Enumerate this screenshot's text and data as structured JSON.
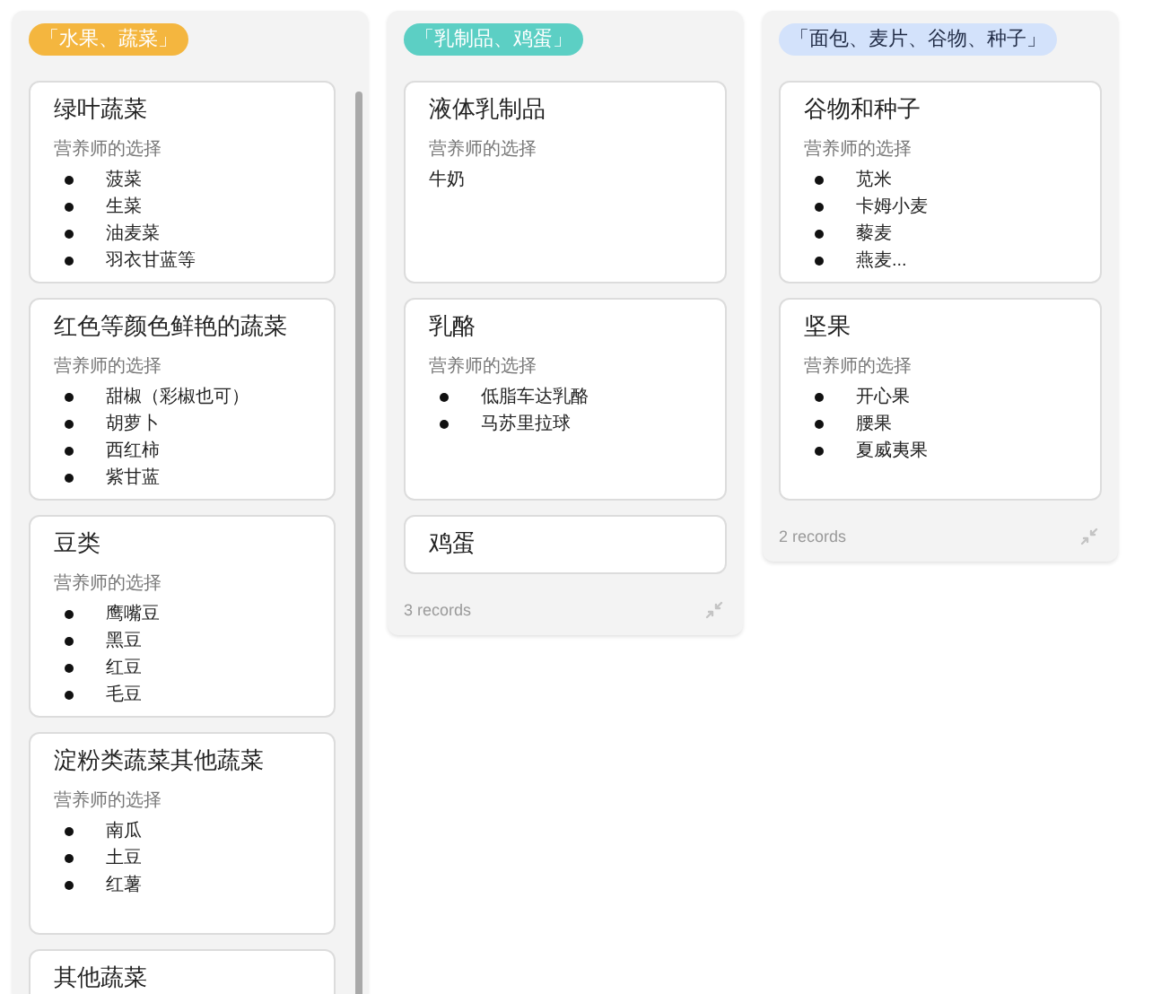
{
  "columns": [
    {
      "label": "「水果、蔬菜」",
      "color": "#f4b63f",
      "cards": [
        {
          "title": "绿叶蔬菜",
          "field_label": "营养师的选择",
          "kind": "list",
          "items": [
            "菠菜",
            "生菜",
            "油麦菜",
            "羽衣甘蓝等"
          ]
        },
        {
          "title": "红色等颜色鲜艳的蔬菜",
          "field_label": "营养师的选择",
          "kind": "list",
          "items": [
            "甜椒（彩椒也可）",
            "胡萝卜",
            "西红柿",
            "紫甘蓝"
          ]
        },
        {
          "title": "豆类",
          "field_label": "营养师的选择",
          "kind": "list",
          "items": [
            "鹰嘴豆",
            "黑豆",
            "红豆",
            "毛豆"
          ]
        },
        {
          "title": "淀粉类蔬菜其他蔬菜",
          "field_label": "营养师的选择",
          "kind": "list",
          "items": [
            "南瓜",
            "土豆",
            "红薯"
          ]
        },
        {
          "title": "其他蔬菜"
        }
      ]
    },
    {
      "label": "「乳制品、鸡蛋」",
      "color": "#5ccfc4",
      "footer": "3 records",
      "cards": [
        {
          "title": "液体乳制品",
          "field_label": "营养师的选择",
          "kind": "text",
          "items": [
            "牛奶"
          ]
        },
        {
          "title": "乳酪",
          "field_label": "营养师的选择",
          "kind": "list",
          "items": [
            "低脂车达乳酪",
            "马苏里拉球"
          ]
        },
        {
          "title": "鸡蛋"
        }
      ]
    },
    {
      "label": "「面包、麦片、谷物、种子」",
      "color": "#d3e2fb",
      "footer": "2 records",
      "cards": [
        {
          "title": "谷物和种子",
          "field_label": "营养师的选择",
          "kind": "list",
          "items": [
            "苋米",
            "卡姆小麦",
            "藜麦",
            "燕麦..."
          ]
        },
        {
          "title": "坚果",
          "field_label": "营养师的选择",
          "kind": "list",
          "items": [
            "开心果",
            "腰果",
            "夏威夷果"
          ]
        }
      ]
    }
  ]
}
